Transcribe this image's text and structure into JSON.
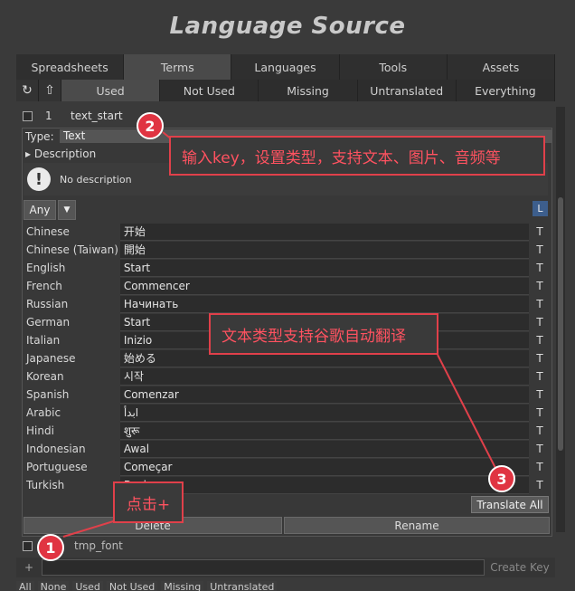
{
  "title": "Language Source",
  "tabs": [
    {
      "label": "Spreadsheets",
      "active": false
    },
    {
      "label": "Terms",
      "active": true
    },
    {
      "label": "Languages",
      "active": false
    },
    {
      "label": "Tools",
      "active": false
    },
    {
      "label": "Assets",
      "active": false
    }
  ],
  "filters": [
    {
      "label": "Used",
      "active": true
    },
    {
      "label": "Not Used",
      "active": false
    },
    {
      "label": "Missing",
      "active": false
    },
    {
      "label": "Untranslated",
      "active": false
    },
    {
      "label": "Everything",
      "active": false
    }
  ],
  "key": {
    "index": "1",
    "name": "text_start"
  },
  "type": {
    "label": "Type:",
    "value": "Text"
  },
  "description": {
    "label": "Description",
    "placeholder": "No description"
  },
  "lang_filter": {
    "any": "Any",
    "l": "L"
  },
  "languages": [
    {
      "name": "Chinese",
      "value": "开始"
    },
    {
      "name": "Chinese (Taiwan)",
      "value": "開始"
    },
    {
      "name": "English",
      "value": "Start"
    },
    {
      "name": "French",
      "value": "Commencer"
    },
    {
      "name": "Russian",
      "value": "Начинать"
    },
    {
      "name": "German",
      "value": "Start"
    },
    {
      "name": "Italian",
      "value": "Inizio"
    },
    {
      "name": "Japanese",
      "value": "始める"
    },
    {
      "name": "Korean",
      "value": "시작"
    },
    {
      "name": "Spanish",
      "value": "Comenzar"
    },
    {
      "name": "Arabic",
      "value": "ابدأ"
    },
    {
      "name": "Hindi",
      "value": "शुरू"
    },
    {
      "name": "Indonesian",
      "value": "Awal"
    },
    {
      "name": "Portuguese",
      "value": "Começar"
    },
    {
      "name": "Turkish",
      "value": "Başlangıç"
    }
  ],
  "t_label": "T",
  "buttons": {
    "translate_all": "Translate All",
    "delete": "Delete",
    "rename": "Rename",
    "create_key": "Create Key",
    "add": "+"
  },
  "key2": {
    "name": "tmp_font"
  },
  "bottom_buttons": [
    "All",
    "None",
    "Used",
    "Not Used",
    "Missing",
    "Untranslated"
  ],
  "annotations": [
    {
      "num": "1",
      "text": "点击+"
    },
    {
      "num": "2",
      "text": "输入key，设置类型，支持文本、图片、音频等"
    },
    {
      "num": "3",
      "text": "文本类型支持谷歌自动翻译"
    }
  ],
  "annotation_color": "#e0404a"
}
